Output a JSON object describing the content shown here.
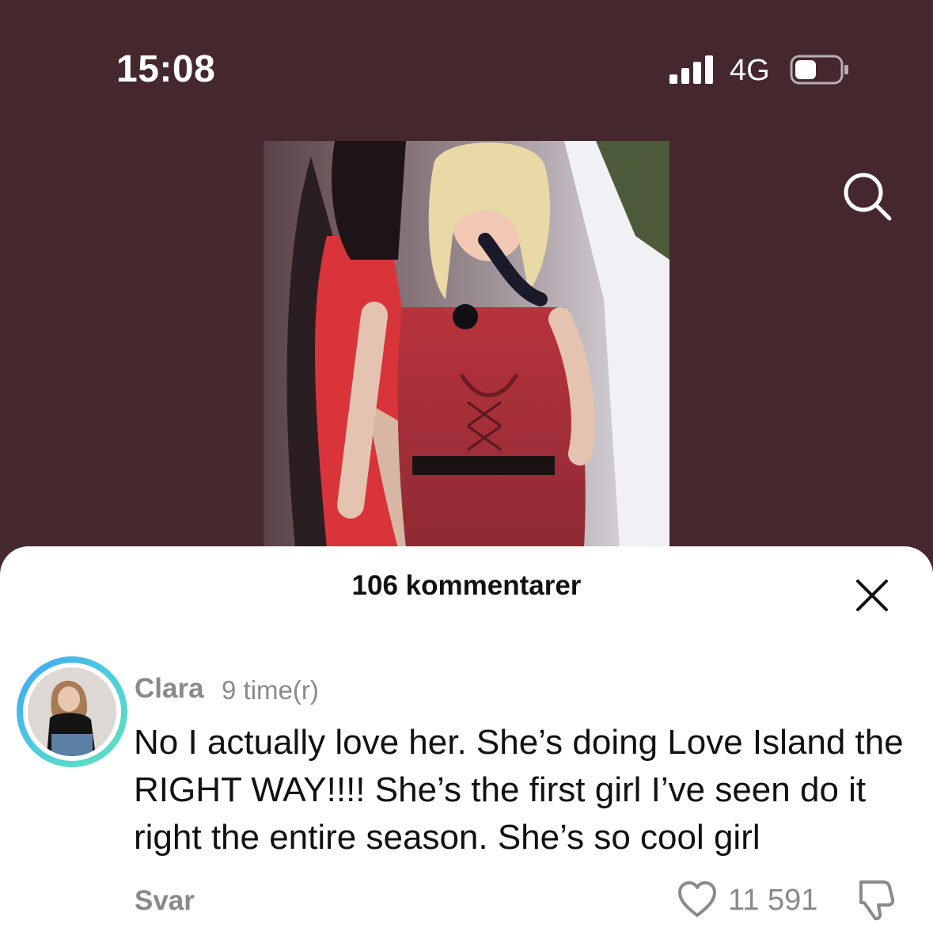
{
  "status_bar": {
    "time": "15:08",
    "network": "4G"
  },
  "sheet": {
    "title": "106 kommentarer",
    "comment": {
      "username": "Clara",
      "time_ago": "9 time(r)",
      "text": "No I actually love her. She’s doing Love Island the RIGHT WAY!!!! She’s the first girl I’ve seen do it right the entire season. She’s so cool girl",
      "reply_label": "Svar",
      "like_count": "11 591"
    }
  },
  "icons": {
    "search": "search-icon",
    "close": "close-icon",
    "like": "heart-icon",
    "dislike": "thumbs-down-icon",
    "signal": "signal-icon",
    "battery": "battery-icon"
  },
  "colors": {
    "background": "#45272e",
    "sheet": "#ffffff",
    "text_primary": "#111111",
    "text_secondary": "#8a8a8a",
    "avatar_ring_start": "#3fa3f5",
    "avatar_ring_end": "#62e0b8"
  }
}
